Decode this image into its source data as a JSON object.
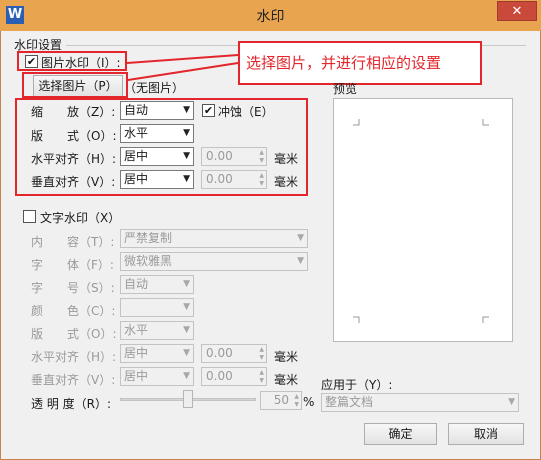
{
  "window": {
    "title": "水印",
    "app_icon": "W",
    "close_glyph": "✕"
  },
  "group": {
    "title": "水印设置"
  },
  "picture": {
    "checkbox_label": "图片水印（I）:",
    "checked_glyph": "✔",
    "select_button": "选择图片（P）",
    "no_picture": "（无图片）",
    "scale_label": "缩　　放（Z）:",
    "scale_value": "自动",
    "washout_label": "冲蚀（E）",
    "layout_label": "版　　式（O）:",
    "layout_value": "水平",
    "halign_label": "水平对齐（H）:",
    "halign_value": "居中",
    "halign_offset": "0.00",
    "valign_label": "垂直对齐（V）:",
    "valign_value": "居中",
    "valign_offset": "0.00",
    "unit": "毫米"
  },
  "callout": {
    "text": "选择图片，并进行相应的设置",
    "color": "#e2262c"
  },
  "text_wm": {
    "checkbox_label": "文字水印（X）",
    "content_label": "内　　容（T）:",
    "content_value": "严禁复制",
    "font_label": "字　　体（F）:",
    "font_value": "微软雅黑",
    "size_label": "字　　号（S）:",
    "size_value": "自动",
    "color_label": "颜　　色（C）:",
    "layout_label": "版　　式（O）:",
    "layout_value": "水平",
    "halign_label": "水平对齐（H）:",
    "halign_value": "居中",
    "halign_offset": "0.00",
    "valign_label": "垂直对齐（V）:",
    "valign_value": "居中",
    "valign_offset": "0.00",
    "unit": "毫米",
    "transparency_label": "透 明 度（R）:",
    "transparency_value": "50",
    "percent": "%"
  },
  "preview": {
    "title": "预览"
  },
  "apply": {
    "label": "应用于（Y）:",
    "value": "整篇文档"
  },
  "buttons": {
    "ok": "确定",
    "cancel": "取消"
  },
  "colors": {
    "titlebar": "#e9a44f",
    "annotation": "#e2262c",
    "close": "#c94a3a"
  }
}
